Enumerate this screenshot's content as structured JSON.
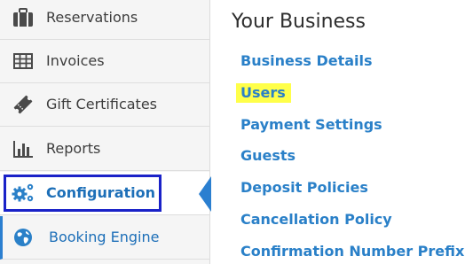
{
  "sidebar": {
    "items": [
      {
        "label": "Reservations",
        "icon": "briefcase-icon"
      },
      {
        "label": "Invoices",
        "icon": "table-icon"
      },
      {
        "label": "Gift Certificates",
        "icon": "ticket-icon"
      },
      {
        "label": "Reports",
        "icon": "bar-chart-icon"
      },
      {
        "label": "Configuration",
        "icon": "gears-icon",
        "active": true
      },
      {
        "label": "Booking Engine",
        "icon": "globe-icon"
      }
    ]
  },
  "main": {
    "title": "Your Business",
    "links": [
      {
        "label": "Business Details"
      },
      {
        "label": "Users",
        "highlighted": true
      },
      {
        "label": "Payment Settings"
      },
      {
        "label": "Guests"
      },
      {
        "label": "Deposit Policies"
      },
      {
        "label": "Cancellation Policy"
      },
      {
        "label": "Confirmation Number Prefixes"
      }
    ]
  },
  "colors": {
    "accent": "#2a80c8",
    "active_label": "#1d6fb8",
    "highlight": "#ffff4a",
    "annotation_box": "#1a22c8"
  }
}
